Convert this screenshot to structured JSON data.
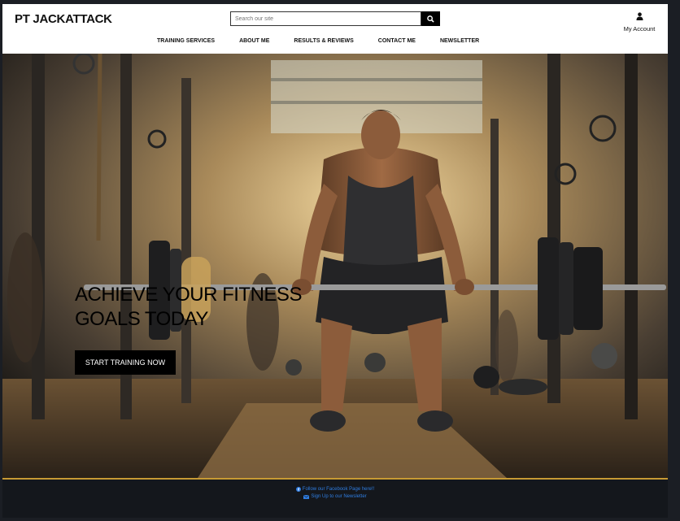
{
  "site": {
    "logo": "PT JACKATTACK"
  },
  "search": {
    "placeholder": "Search our site",
    "icon": "search-icon"
  },
  "account": {
    "label": "My Account",
    "icon": "user-icon"
  },
  "nav": {
    "items": [
      "TRAINING SERVICES",
      "ABOUT ME",
      "RESULTS & REVIEWS",
      "CONTACT ME",
      "NEWSLETTER"
    ]
  },
  "hero": {
    "headline_line1": "ACHIEVE YOUR FITNESS",
    "headline_line2": "GOALS TODAY",
    "cta_label": "START TRAINING NOW",
    "image_subject": "athlete deadlifting barbell in gym"
  },
  "footer": {
    "facebook_label": "Follow our Facebook Page here!!",
    "facebook_icon": "facebook-icon",
    "newsletter_label": "Sign Up to our Newsletter",
    "newsletter_icon": "envelope-icon"
  },
  "colors": {
    "header_bg": "#ffffff",
    "footer_bg": "#14171c",
    "footer_link": "#2f7de1",
    "accent_line": "#c79a34",
    "cta_bg": "#000000"
  }
}
